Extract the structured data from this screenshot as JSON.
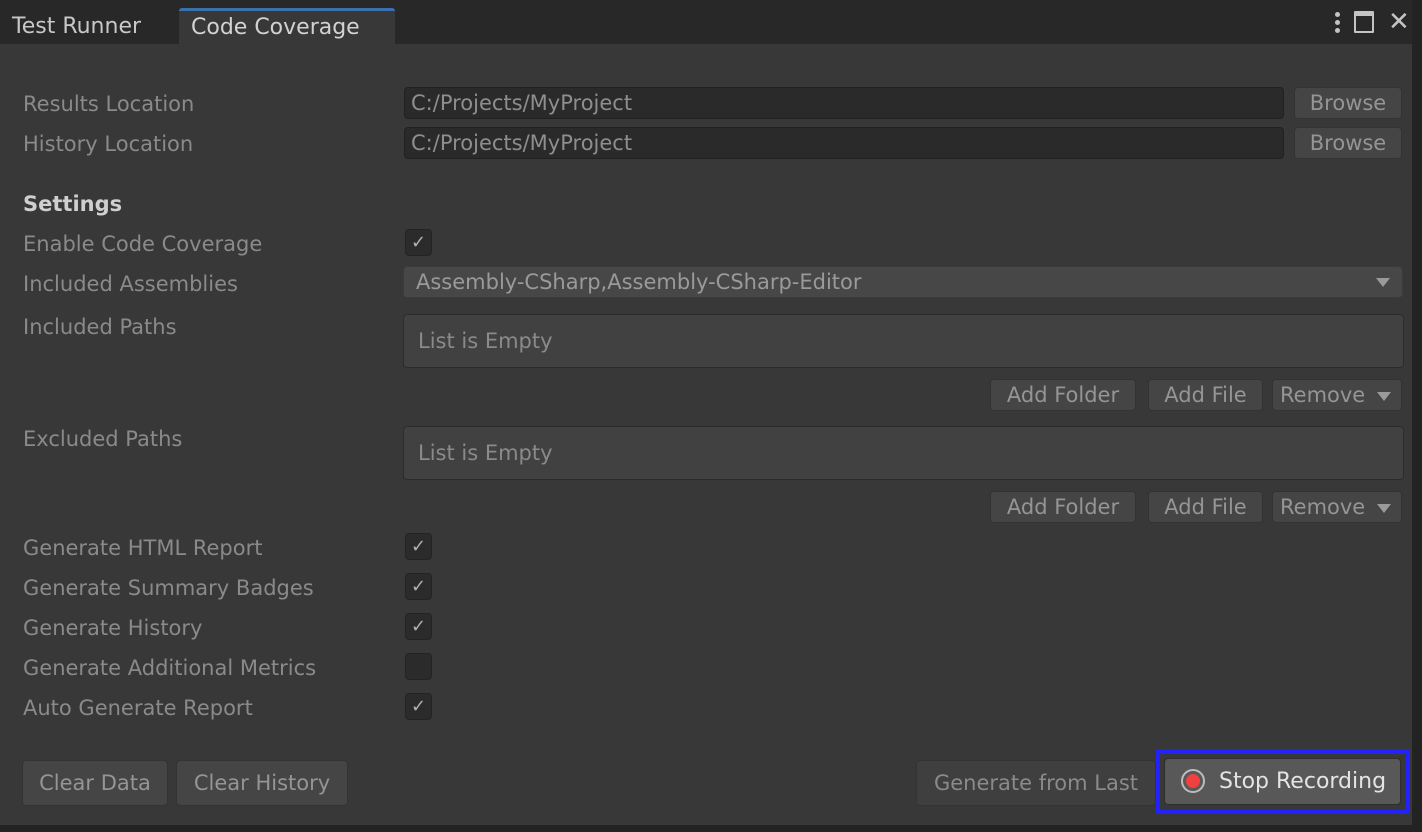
{
  "tabs": [
    {
      "label": "Test Runner",
      "active": false
    },
    {
      "label": "Code Coverage",
      "active": true
    }
  ],
  "window_icons": [
    "kebab-menu-icon",
    "maximize-icon",
    "close-icon"
  ],
  "results_location": {
    "label": "Results Location",
    "value": "C:/Projects/MyProject",
    "browse_label": "Browse"
  },
  "history_location": {
    "label": "History Location",
    "value": "C:/Projects/MyProject",
    "browse_label": "Browse"
  },
  "settings": {
    "heading": "Settings",
    "enable_code_coverage": {
      "label": "Enable Code Coverage",
      "checked": true,
      "mark": "✓"
    },
    "included_assemblies": {
      "label": "Included Assemblies",
      "value": "Assembly-CSharp,Assembly-CSharp-Editor"
    },
    "included_paths": {
      "label": "Included Paths",
      "empty_text": "List is Empty",
      "add_folder": "Add Folder",
      "add_file": "Add File",
      "remove": "Remove"
    },
    "excluded_paths": {
      "label": "Excluded Paths",
      "empty_text": "List is Empty",
      "add_folder": "Add Folder",
      "add_file": "Add File",
      "remove": "Remove"
    },
    "options": [
      {
        "label": "Generate HTML Report",
        "checked": true,
        "mark": "✓"
      },
      {
        "label": "Generate Summary Badges",
        "checked": true,
        "mark": "✓"
      },
      {
        "label": "Generate History",
        "checked": true,
        "mark": "✓"
      },
      {
        "label": "Generate Additional Metrics",
        "checked": false,
        "mark": ""
      },
      {
        "label": "Auto Generate Report",
        "checked": true,
        "mark": "✓"
      }
    ]
  },
  "footer": {
    "clear_data": "Clear Data",
    "clear_history": "Clear History",
    "generate_from_last": "Generate from Last",
    "stop_recording": "Stop Recording"
  },
  "colors": {
    "tab_accent": "#3a72b0",
    "record_dot": "#f04040",
    "highlight_frame": "#2222ff"
  }
}
